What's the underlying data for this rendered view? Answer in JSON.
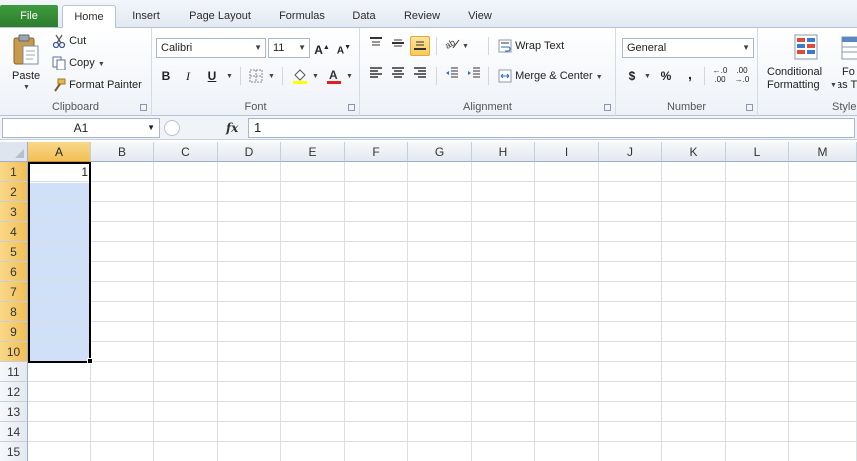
{
  "tabs": [
    "File",
    "Home",
    "Insert",
    "Page Layout",
    "Formulas",
    "Data",
    "Review",
    "View"
  ],
  "active_tab": "Home",
  "clipboard": {
    "paste": "Paste",
    "cut": "Cut",
    "copy": "Copy",
    "format_painter": "Format Painter",
    "label": "Clipboard"
  },
  "font": {
    "name": "Calibri",
    "size": "11",
    "bold": "B",
    "italic": "I",
    "underline": "U",
    "label": "Font"
  },
  "alignment": {
    "wrap_text": "Wrap Text",
    "merge_center": "Merge & Center",
    "label": "Alignment"
  },
  "number": {
    "format": "General",
    "currency": "$",
    "percent": "%",
    "comma": ",",
    "label": "Number"
  },
  "styles": {
    "conditional_line1": "Conditional",
    "conditional_line2": "Formatting",
    "format_table_line1": "Fo",
    "format_table_line2": "as T",
    "label": "Style"
  },
  "formula_bar": {
    "name_box": "A1",
    "fx": "fx",
    "value": "1"
  },
  "columns": [
    "A",
    "B",
    "C",
    "D",
    "E",
    "F",
    "G",
    "H",
    "I",
    "J",
    "K",
    "L",
    "M"
  ],
  "rows": [
    "1",
    "2",
    "3",
    "4",
    "5",
    "6",
    "7",
    "8",
    "9",
    "10",
    "11",
    "12",
    "13",
    "14",
    "15"
  ],
  "selected_column": "A",
  "selected_rows": [
    "1",
    "2",
    "3",
    "4",
    "5",
    "6",
    "7",
    "8",
    "9",
    "10"
  ],
  "selection_range": "A1:A10",
  "cells": {
    "A1": "1"
  },
  "colors": {
    "file_tab": "#2c7d2c",
    "selection_fill": "#cfe0f8",
    "header_highlight": "#f2bf55"
  }
}
